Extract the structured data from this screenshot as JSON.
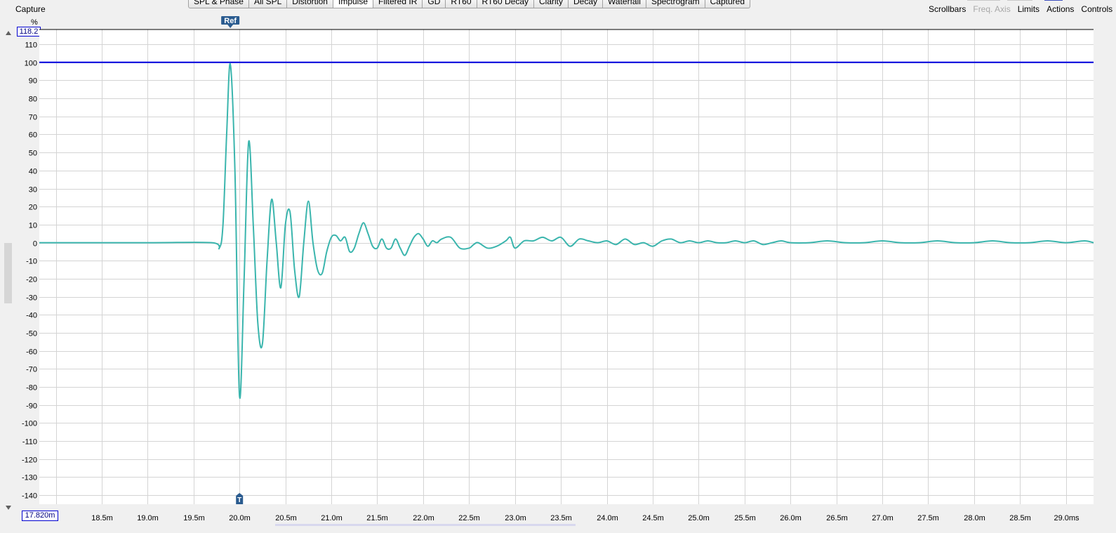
{
  "header": {
    "capture_label": "Capture",
    "tabs": [
      {
        "label": "SPL & Phase",
        "active": false
      },
      {
        "label": "All SPL",
        "active": false
      },
      {
        "label": "Distortion",
        "active": false
      },
      {
        "label": "Impulse",
        "active": true
      },
      {
        "label": "Filtered IR",
        "active": false
      },
      {
        "label": "GD",
        "active": false
      },
      {
        "label": "RT60",
        "active": false
      },
      {
        "label": "RT60 Decay",
        "active": false
      },
      {
        "label": "Clarity",
        "active": false
      },
      {
        "label": "Decay",
        "active": false
      },
      {
        "label": "Waterfall",
        "active": false
      },
      {
        "label": "Spectrogram",
        "active": false
      },
      {
        "label": "Captured",
        "active": false
      }
    ],
    "right_menu": {
      "scrollbars": "Scrollbars",
      "freq_axis": "Freq. Axis",
      "limits": "Limits",
      "actions": "Actions",
      "controls": "Controls"
    }
  },
  "axis_controls": {
    "y_unit": "%",
    "y_max_value": "118.2",
    "x_min_value": "17.820m"
  },
  "colors": {
    "trace": "#3ab5ad",
    "reference_line": "#0000e0",
    "grid": "#d4d4d4",
    "plot_background": "#ffffff",
    "marker": "#2a5b8f"
  },
  "markers": {
    "ref_label": "Ref",
    "t_label": "T",
    "ref_x_ms": 19.9
  },
  "chart_data": {
    "type": "line",
    "xlim": [
      17.82,
      29.3
    ],
    "ylim": [
      -145,
      118.2
    ],
    "x_unit": "ms",
    "x_ticks": [
      18.0,
      18.5,
      19.0,
      19.5,
      20.0,
      20.5,
      21.0,
      21.5,
      22.0,
      22.5,
      23.0,
      23.5,
      24.0,
      24.5,
      25.0,
      25.5,
      26.0,
      26.5,
      27.0,
      27.5,
      28.0,
      28.5,
      29.0
    ],
    "x_tick_labels": [
      "",
      "18.5m",
      "19.0m",
      "19.5m",
      "20.0m",
      "20.5m",
      "21.0m",
      "21.5m",
      "22.0m",
      "22.5m",
      "23.0m",
      "23.5m",
      "24.0m",
      "24.5m",
      "25.0m",
      "25.5m",
      "26.0m",
      "26.5m",
      "27.0m",
      "27.5m",
      "28.0m",
      "28.5m",
      "29.0ms"
    ],
    "y_ticks": [
      110,
      100,
      90,
      80,
      70,
      60,
      50,
      40,
      30,
      20,
      10,
      0,
      -10,
      -20,
      -30,
      -40,
      -50,
      -60,
      -70,
      -80,
      -90,
      -100,
      -110,
      -120,
      -130,
      -140
    ],
    "reference_level": 100,
    "grid": true,
    "series": [
      {
        "x": [
          17.82,
          19.0,
          19.7,
          19.78,
          19.82,
          19.86,
          19.9,
          19.95,
          20.0,
          20.05,
          20.1,
          20.15,
          20.2,
          20.25,
          20.3,
          20.35,
          20.4,
          20.45,
          20.5,
          20.55,
          20.6,
          20.65,
          20.7,
          20.75,
          20.8,
          20.85,
          20.9,
          20.95,
          21.0,
          21.05,
          21.1,
          21.15,
          21.2,
          21.25,
          21.3,
          21.35,
          21.4,
          21.45,
          21.5,
          21.55,
          21.6,
          21.65,
          21.7,
          21.75,
          21.8,
          21.85,
          21.9,
          21.95,
          22.0,
          22.05,
          22.1,
          22.15,
          22.2,
          22.3,
          22.4,
          22.5,
          22.55,
          22.6,
          22.7,
          22.8,
          22.9,
          22.95,
          23.0,
          23.1,
          23.2,
          23.3,
          23.4,
          23.5,
          23.6,
          23.7,
          23.8,
          23.9,
          24.0,
          24.1,
          24.2,
          24.3,
          24.4,
          24.5,
          24.6,
          24.7,
          24.8,
          24.9,
          25.0,
          25.1,
          25.2,
          25.3,
          25.4,
          25.5,
          25.6,
          25.7,
          25.8,
          25.9,
          26.0,
          26.2,
          26.4,
          26.6,
          26.8,
          27.0,
          27.2,
          27.4,
          27.6,
          27.8,
          28.0,
          28.2,
          28.4,
          28.6,
          28.8,
          29.0,
          29.2,
          29.3
        ],
        "y": [
          0,
          0,
          0,
          -3,
          10,
          60,
          99,
          40,
          -85,
          -20,
          56,
          10,
          -45,
          -56,
          -10,
          24,
          0,
          -25,
          10,
          17,
          -15,
          -30,
          0,
          23,
          0,
          -15,
          -17,
          -5,
          3,
          4,
          1,
          3,
          -5,
          -3,
          5,
          11,
          5,
          -2,
          -3,
          2,
          -3,
          -3,
          2,
          -3,
          -7,
          -2,
          3,
          5,
          2,
          -2,
          1,
          0,
          2,
          3,
          -3,
          -3,
          -1,
          0,
          -3,
          -2,
          1,
          3,
          -3,
          1,
          1,
          3,
          1,
          3,
          -2,
          2,
          1,
          0,
          1,
          -1,
          2,
          -1,
          0,
          -2,
          1,
          2,
          0,
          1,
          0,
          1,
          0,
          0,
          1,
          0,
          1,
          -1,
          0,
          1,
          0,
          0,
          1,
          0,
          0,
          1,
          0,
          0,
          1,
          0,
          0,
          1,
          0,
          0,
          1,
          0,
          1,
          0
        ]
      }
    ]
  }
}
